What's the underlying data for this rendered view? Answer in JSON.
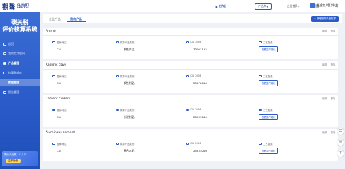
{
  "brand": {
    "cn": "觀聲",
    "en_line1": "CLIMATE",
    "en_line2": "VERITAS"
  },
  "sidebar": {
    "system_title_line1": "碳关税",
    "system_title_line2": "评价核算系统",
    "items": [
      {
        "label": "首页",
        "active": false
      },
      {
        "label": "我的工作空间",
        "active": false
      },
      {
        "label": "产品管理",
        "active": true
      },
      {
        "label": "核算数据库",
        "active": false
      },
      {
        "label": "数据管理",
        "active": false
      },
      {
        "label": "报告管理",
        "active": false
      }
    ],
    "remaining_label": "剩余产品数：11/10",
    "upgrade_label": "立即升级"
  },
  "topbar": {
    "work_label": "工作台",
    "product_label": "产品库",
    "home_label": "企业首页",
    "username": "张逸悠，嘉华科技"
  },
  "tabs": [
    {
      "label": "企业产品",
      "active": false
    },
    {
      "label": "我的产品",
      "active": true
    }
  ],
  "add_button_label": "+ 新增碳排产品核算",
  "card_actions": {
    "edit": "编辑",
    "delete": "删除"
  },
  "columns": {
    "region": "国家/地区",
    "category": "核算产品类别",
    "cn_code": "CN CODE",
    "process": "工艺路线"
  },
  "report_button_label": "查看生产路线",
  "products": [
    {
      "name": "Ammo",
      "region": "CN",
      "category": "钢铁产品",
      "cn_code": "73061152"
    },
    {
      "name": "Kaolinic clays",
      "region": "CN",
      "category": "钢铁制品",
      "cn_code": "25070000"
    },
    {
      "name": "Cement clinkers",
      "region": "CN",
      "category": "水泥制品",
      "cn_code": "25231000"
    },
    {
      "name": "Aluminous cement",
      "region": "CN",
      "category": "黑色水泥",
      "cn_code": "25233000"
    }
  ]
}
